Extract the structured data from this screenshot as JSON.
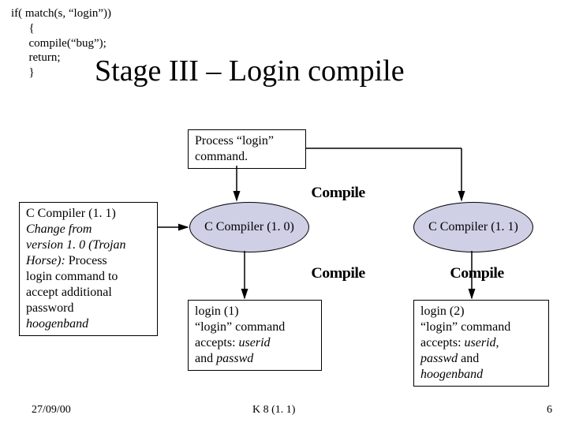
{
  "code": "if( match(s, “login”))\n      {\n      compile(“bug”);\n      return;\n      }",
  "title": "Stage III – Login compile",
  "process_box": "Process “login”\ncommand.",
  "left_box": {
    "plain1": "C Compiler (1. 1)",
    "italic1": "Change from\nversion 1. 0 (Trojan\nHorse):",
    "plain2": " Process\nlogin command to\naccept additional\npassword",
    "italic2": "hoogenband"
  },
  "oval1": "C Compiler\n(1. 0)",
  "oval2": "C Compiler\n(1. 1)",
  "login1": {
    "p1": "login (1)",
    "p2": "“login” command\naccepts: ",
    "i1": "userid",
    "p3": "\nand ",
    "i2": "passwd"
  },
  "login2": {
    "p1": "login (2)",
    "p2": "“login” command\naccepts: ",
    "i1": "userid",
    "p3": ",\n",
    "i2": "passwd",
    "p4": " and\n",
    "i3": "hoogenband"
  },
  "compile_label": "Compile",
  "footer_left": "27/09/00",
  "footer_center": "K 8 (1. 1)",
  "footer_right": "6"
}
